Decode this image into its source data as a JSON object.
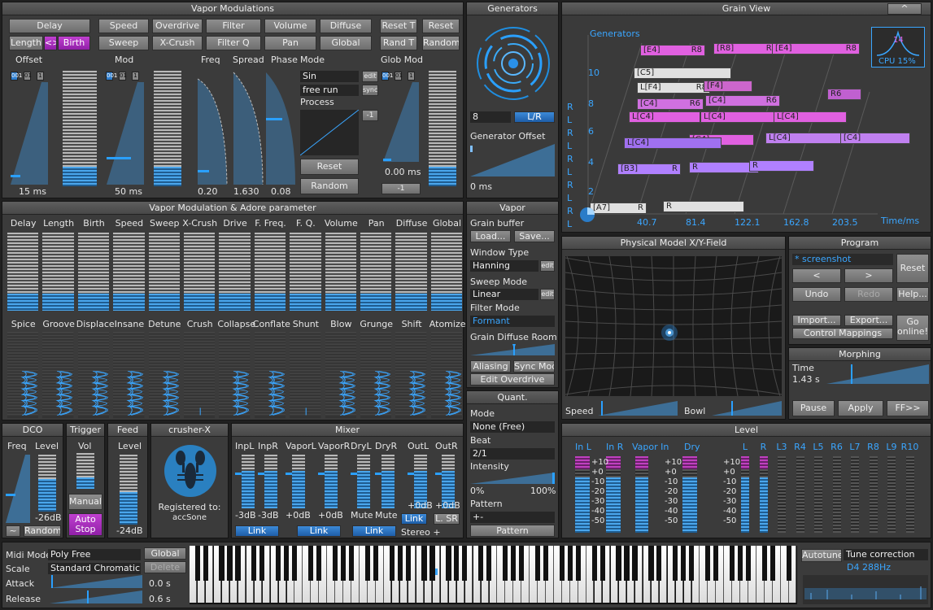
{
  "vapor_mod": {
    "title": "Vapor Modulations",
    "row1": [
      "Delay",
      "Speed",
      "Overdrive",
      "Filter",
      "Volume",
      "Diffuse",
      "Reset T",
      "Reset"
    ],
    "row2": [
      "Length",
      "<>",
      "Birth",
      "Sweep",
      "X-Crush",
      "Filter Q",
      "Pan",
      "Global",
      "Rand T",
      "Random"
    ],
    "labels": {
      "offset": "Offset",
      "mod": "Mod",
      "freq": "Freq",
      "spread": "Spread",
      "phase": "Phase",
      "mode": "Mode",
      "glob_mod": "Glob Mod"
    },
    "small_btn": [
      "001",
      "01",
      "1"
    ],
    "mode_value": "Sin",
    "edit": "edit",
    "run_value": "free run",
    "sync": "sync",
    "process": "Process",
    "minus1": "-1",
    "reset": "Reset",
    "random": "Random",
    "values": {
      "offset": "15 ms",
      "mod": "50 ms",
      "freq": "0.20",
      "spread": "1.630",
      "phase": "0.08",
      "glob": "0.00 ms",
      "glob_btn": "-1"
    }
  },
  "generators": {
    "title": "Generators",
    "count": "8",
    "lr": "L/R",
    "offset_label": "Generator Offset",
    "offset_value": "0 ms"
  },
  "grain_view": {
    "title": "Grain View",
    "caret": "^",
    "axis_label": "Generators",
    "x_label": "Time/ms",
    "x_ticks": [
      "40.7",
      "81.4",
      "122.1",
      "162.8",
      "203.5"
    ],
    "y_ticks": [
      "10",
      "8",
      "6",
      "4",
      "2"
    ],
    "lr": [
      "R",
      "L",
      "R",
      "L",
      "R",
      "L",
      "R",
      "L",
      "R",
      "L"
    ],
    "cpu_value": "14",
    "cpu": "CPU 15%",
    "grains": [
      {
        "t": "[E4]",
        "r": "R8",
        "c": "#e060e0"
      },
      {
        "t": "[R8]",
        "r": "R8",
        "c": "#e060e0"
      },
      {
        "t": "[E4]",
        "r": "R8",
        "c": "#e060e0"
      },
      {
        "t": "[C5]",
        "r": "",
        "c": "#e0e0e0"
      },
      {
        "t": "L[F4]",
        "r": "R8",
        "c": "#e0e0e0"
      },
      {
        "t": "[F4]",
        "r": "",
        "c": "#cc66cc"
      },
      {
        "t": "[C4]",
        "r": "R6",
        "c": "#d070e0"
      },
      {
        "t": "[C4]",
        "r": "R6",
        "c": "#d070e0"
      },
      {
        "t": "R6",
        "r": "",
        "c": "#c060d0"
      },
      {
        "t": "L[C4]",
        "r": "",
        "c": "#e060e0"
      },
      {
        "t": "L[C4]",
        "r": "",
        "c": "#e060e0"
      },
      {
        "t": "L[C4]",
        "r": "",
        "c": "#e060e0"
      },
      {
        "t": "[C4]",
        "r": "",
        "c": "#e060e0"
      },
      {
        "t": "L[C4]",
        "r": "",
        "c": "#c080f0"
      },
      {
        "t": "[C4]",
        "r": "",
        "c": "#c080f0"
      },
      {
        "t": "L[C4]",
        "r": "",
        "c": "#a070f0"
      },
      {
        "t": "[B3]",
        "r": "R",
        "c": "#b080ff"
      },
      {
        "t": "R",
        "r": "",
        "c": "#b080ff"
      },
      {
        "t": "R",
        "r": "",
        "c": "#b080ff"
      },
      {
        "t": "[A7]",
        "r": "R",
        "c": "#e0e0e0"
      },
      {
        "t": "R",
        "r": "",
        "c": "#e0e0e0"
      }
    ]
  },
  "adore": {
    "title": "Vapor Modulation & Adore parameter",
    "row1": [
      "Delay",
      "Length",
      "Birth",
      "Speed",
      "Sweep",
      "X-Crush",
      "Drive",
      "F. Freq.",
      "F. Q.",
      "Volume",
      "Pan",
      "Diffuse",
      "Global"
    ],
    "row1_levels": [
      0.22,
      0.22,
      0.22,
      0.22,
      0.22,
      0.22,
      0.22,
      0.22,
      0.22,
      0.22,
      0.22,
      0.22,
      0.22
    ],
    "row2": [
      "Spice",
      "Groove",
      "Displace",
      "Insane",
      "Detune",
      "Crush",
      "Collapse",
      "Conflate",
      "Shunt",
      "Blow",
      "Grunge",
      "Shift",
      "Atomize"
    ]
  },
  "vapor": {
    "title": "Vapor",
    "grain_buffer": "Grain buffer",
    "load": "Load...",
    "save": "Save...",
    "window_type": "Window Type",
    "window_value": "Hanning",
    "edit": "edit",
    "sweep_mode": "Sweep Mode",
    "sweep_value": "Linear",
    "filter_mode": "Filter Mode",
    "filter_value": "Formant",
    "diffuse_room": "Grain Diffuse Room",
    "aliasing": "Aliasing",
    "sync_mod": "Sync Mod",
    "edit_overdrive": "Edit Overdrive"
  },
  "quant": {
    "title": "Quant.",
    "mode": "Mode",
    "mode_value": "None (Free)",
    "beat": "Beat",
    "beat_value": "2/1",
    "intensity": "Intensity",
    "min": "0%",
    "max": "100%",
    "pattern_label": "Pattern",
    "pattern_value": "+-",
    "pattern_btn": "Pattern"
  },
  "physical": {
    "title": "Physical Model X/Y-Field",
    "speed": "Speed",
    "bowl": "Bowl"
  },
  "program": {
    "title": "Program",
    "name": "* screenshot",
    "prev": "<",
    "next": ">",
    "reset": "Reset",
    "undo": "Undo",
    "redo": "Redo",
    "help": "Help...",
    "import": "Import...",
    "export": "Export...",
    "control": "Control Mappings",
    "go_online": "Go online!"
  },
  "morphing": {
    "title": "Morphing",
    "time_label": "Time",
    "time_value": "1.43 s",
    "pause": "Pause",
    "apply": "Apply",
    "ff": "FF>>"
  },
  "dco": {
    "title": "DCO",
    "freq": "Freq",
    "level": "Level",
    "db": "-26dB",
    "tilde": "~",
    "random": "Random"
  },
  "trigger": {
    "title": "Trigger",
    "vol": "Vol",
    "manual": "Manual",
    "auto_stop": "Auto Stop"
  },
  "feed": {
    "title": "Feed",
    "level": "Level",
    "db": "-24dB"
  },
  "crusher": {
    "title": "crusher-X",
    "registered": "Registered to:",
    "user": "accSone"
  },
  "mixer": {
    "title": "Mixer",
    "ch": [
      "InpL",
      "InpR",
      "VaporL",
      "VaporR",
      "DryL",
      "DryR",
      "OutL",
      "OutR"
    ],
    "vals": [
      "-3dB",
      "-3dB",
      "+0dB",
      "+0dB",
      "Mute",
      "Mute",
      "+0dB",
      "+0dB"
    ],
    "link": "Link",
    "lsr": "L. SR",
    "stereo": "Stereo +"
  },
  "level": {
    "title": "Level",
    "groups": [
      "In L",
      "In R",
      "Vapor In",
      "Dry"
    ],
    "ch": [
      "L",
      "R",
      "L3",
      "R4",
      "L5",
      "R6",
      "L7",
      "R8",
      "L9",
      "R10"
    ],
    "scale": [
      "+10",
      "+0",
      "-10",
      "-20",
      "-30",
      "-40",
      "-50"
    ],
    "scale2": [
      "+10",
      "+0",
      "-10",
      "-20",
      "-30",
      "-40",
      "-50"
    ],
    "scale3": [
      "+10",
      "+0",
      "-10",
      "-20",
      "-30",
      "-40",
      "-50"
    ]
  },
  "midi": {
    "mode_label": "Midi Mode",
    "mode_value": "Poly Free",
    "global": "Global",
    "scale_label": "Scale",
    "scale_value": "Standard Chromatic",
    "delete": "Delete",
    "attack": "Attack",
    "attack_value": "0.0 s",
    "release": "Release",
    "release_value": "0.6 s"
  },
  "autotune": {
    "btn": "Autotune",
    "label": "Tune correction",
    "note": "D4 288Hz"
  }
}
